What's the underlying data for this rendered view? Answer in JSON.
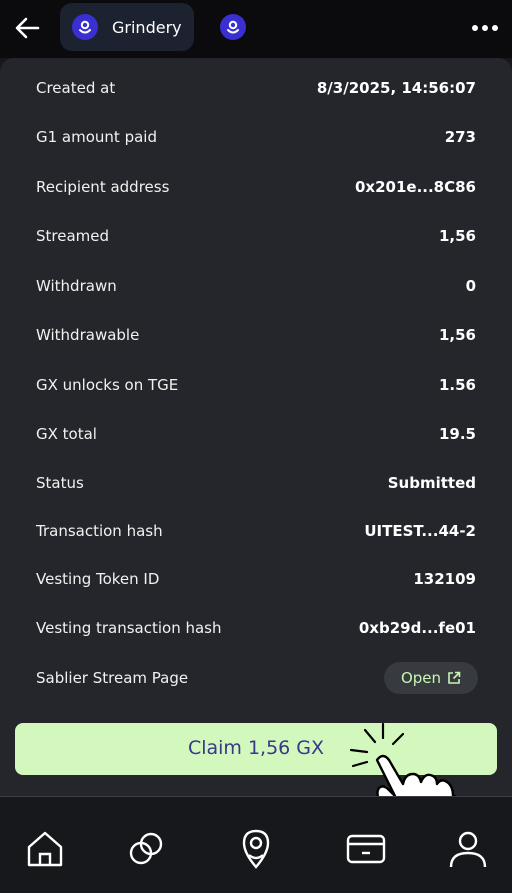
{
  "header": {
    "tab_label": "Grindery",
    "back_icon": "back-arrow-icon",
    "more_icon": "more-dots-icon",
    "logo_icon": "grindery-logo-icon"
  },
  "details": [
    {
      "label": "Created at",
      "value": "8/3/2025, 14:56:07"
    },
    {
      "label": "G1 amount paid",
      "value": "273"
    },
    {
      "label": "Recipient address",
      "value": "0x201e...8C86"
    },
    {
      "label": "Streamed",
      "value": "1,56"
    },
    {
      "label": "Withdrawn",
      "value": "0"
    },
    {
      "label": "Withdrawable",
      "value": "1,56"
    },
    {
      "label": "GX unlocks on TGE",
      "value": "1.56"
    },
    {
      "label": "GX total",
      "value": "19.5"
    },
    {
      "label": "Status",
      "value": "Submitted"
    },
    {
      "label": "Transaction hash",
      "value": "UITEST...44-2"
    },
    {
      "label": "Vesting Token ID",
      "value": "132109"
    },
    {
      "label": "Vesting transaction hash",
      "value": "0xb29d...fe01"
    }
  ],
  "sablier": {
    "label": "Sablier Stream Page",
    "button": "Open"
  },
  "claim": {
    "label": "Claim 1,56 GX"
  },
  "colors": {
    "accent": "#d3f8be",
    "accent_text": "#39378a",
    "logo": "#3a2fd0",
    "open_text": "#c9f5b4"
  },
  "nav": [
    "home-icon",
    "circles-icon",
    "grindery-nav-icon",
    "wallet-icon",
    "profile-icon"
  ]
}
